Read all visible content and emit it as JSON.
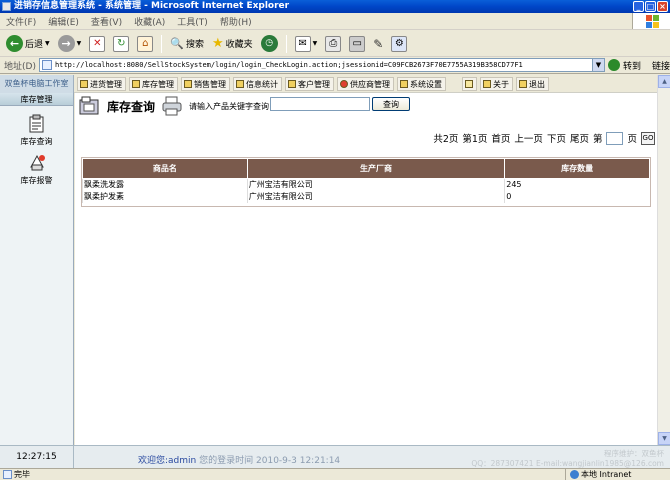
{
  "window": {
    "title": "进销存信息管理系统 - 系统管理 - Microsoft Internet Explorer"
  },
  "menu": [
    "文件(F)",
    "编辑(E)",
    "查看(V)",
    "收藏(A)",
    "工具(T)",
    "帮助(H)"
  ],
  "toolbar": {
    "back_label": "后退",
    "search_label": "搜索",
    "favorites_label": "收藏夹"
  },
  "address": {
    "label": "地址(D)",
    "url": "http://localhost:8080/SellStockSystem/login/login_CheckLogin.action;jsessionid=C09FCB2673F70E7755A319B358CD77F1",
    "go_label": "转到",
    "links_label": "链接"
  },
  "app": {
    "brand": "双鱼杯电脑工作室",
    "nav": [
      "进货管理",
      "库存管理",
      "销售管理",
      "信息统计",
      "客户管理",
      "供应商管理",
      "系统设置"
    ],
    "nav_right": [
      "关于",
      "退出"
    ]
  },
  "sidebar": {
    "title": "库存管理",
    "items": [
      {
        "label": "库存查询",
        "icon": "clipboard-icon"
      },
      {
        "label": "库存报警",
        "icon": "alarm-icon"
      }
    ]
  },
  "main": {
    "title": "库存查询",
    "search_label": "请输入产品关键字查询：",
    "search_value": "",
    "search_button": "查询",
    "pager": {
      "total": "共2页",
      "current": "第1页",
      "first": "首页",
      "prev": "上一页",
      "next": "下页",
      "last": "尾页",
      "goto_prefix": "第",
      "goto_suffix": "页",
      "go_button": "GO"
    },
    "table": {
      "headers": [
        "商品名",
        "生产厂商",
        "库存数量"
      ],
      "rows": [
        [
          "飘柔洗发露",
          "广州宝洁有限公司",
          "245"
        ],
        [
          "飘柔护发素",
          "广州宝洁有限公司",
          "0"
        ]
      ]
    }
  },
  "footer": {
    "clock": "12:27:15",
    "welcome_prefix": "欢迎您:",
    "user": "admin",
    "login_text": "您的登录时间",
    "login_time": "2010-9-3 12:21:14",
    "credit_line1": "程序维护：双鱼杯",
    "credit_line2": "QQ：287307421 E-mail:wangjianlin1985@126.com"
  },
  "status": {
    "left": "完毕",
    "zone": "本地 Intranet"
  },
  "colors": {
    "table_header": "#7a5a4c",
    "titlebar": "#0046c8"
  }
}
